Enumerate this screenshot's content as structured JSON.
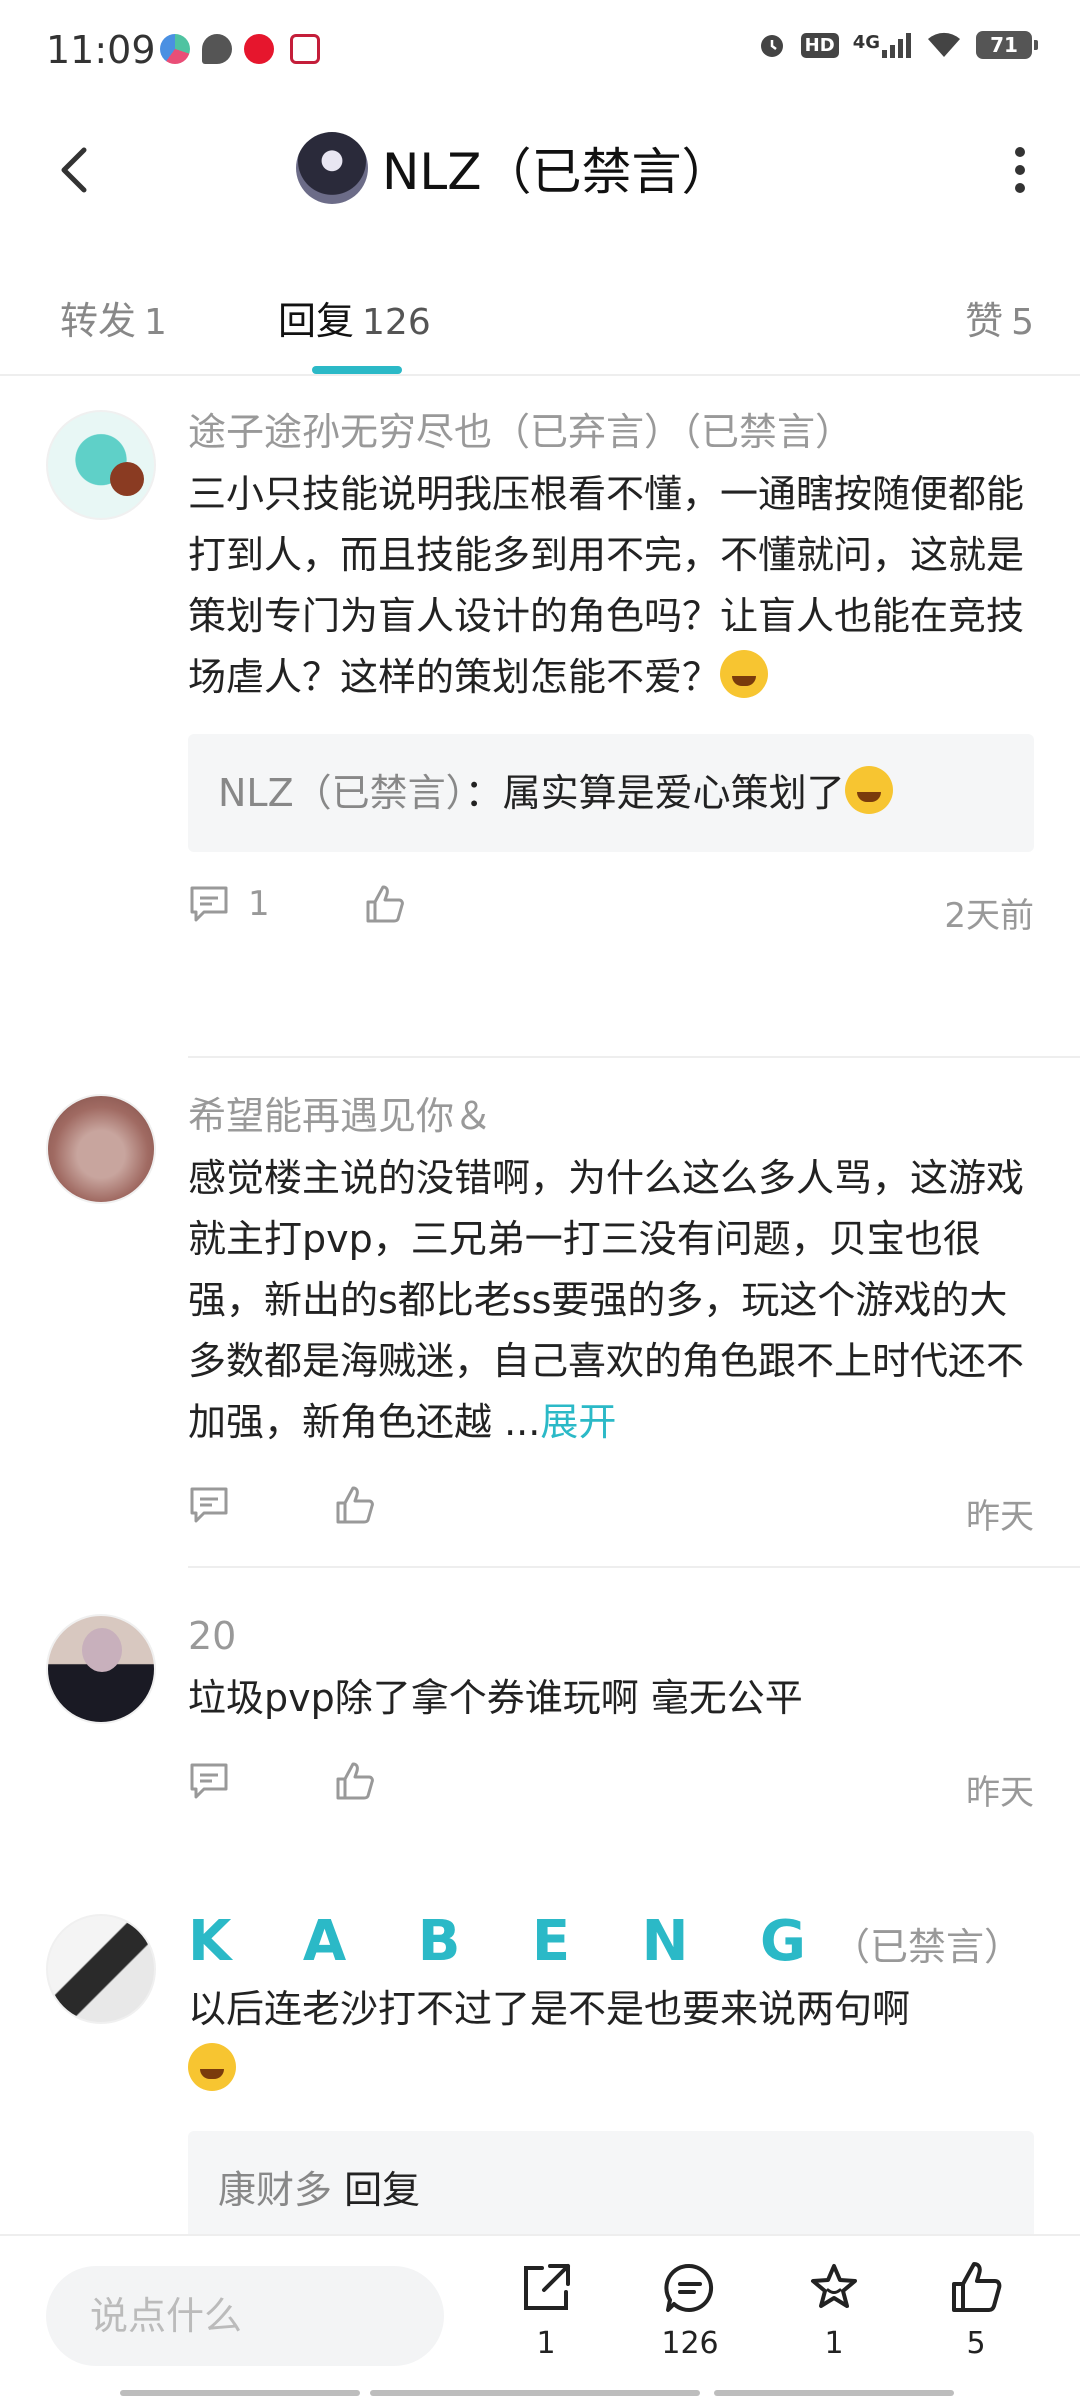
{
  "status": {
    "time": "11:09",
    "network": "4G",
    "hd": "HD",
    "battery": "71",
    "colors": {
      "weibo": "#e6162d",
      "chat": "#555555",
      "app": "#c41e3a"
    }
  },
  "header": {
    "title": "NLZ（已禁言）"
  },
  "tabs": [
    {
      "label": "转发",
      "count": "1"
    },
    {
      "label": "回复",
      "count": "126"
    },
    {
      "label": "赞",
      "count": "5"
    }
  ],
  "active_tab": "回复",
  "posts": [
    {
      "username": "途子途孙无穷尽也（已弃言）（已禁言）",
      "text": "三小只技能说明我压根看不懂，一通瞎按随便都能打到人，而且技能多到用不完，不懂就问，这就是策划专门为盲人设计的角色吗？让盲人也能在竞技场虐人？这样的策划怎能不爱？",
      "emoji": "grin-emoji",
      "quote": {
        "name": "NLZ（已禁言）",
        "text": "：属实算是爱心策划了"
      },
      "comment_count": "1",
      "date": "2天前"
    },
    {
      "username": "希望能再遇见你＆",
      "text": "感觉楼主说的没错啊，为什么这么多人骂，这游戏就主打pvp，三兄弟一打三没有问题，贝宝也很强，新出的s都比老ss要强的多，玩这个游戏的大多数都是海贼迷，自己喜欢的角色跟不上时代还不加强，新角色还越 ...",
      "expand_label": "展开",
      "date": "昨天"
    },
    {
      "username": "20",
      "text": "垃圾pvp除了拿个券谁玩啊 毫无公平",
      "date": "昨天"
    },
    {
      "username": "K A B E N G",
      "username_suffix": "（已禁言）",
      "text": "以后连老沙打不过了是不是也要来说两句啊",
      "quote_partial": {
        "name": "康财多",
        "text": "回复"
      }
    }
  ],
  "bottom": {
    "input_placeholder": "说点什么",
    "share_count": "1",
    "comment_count": "126",
    "favorite_count": "1",
    "like_count": "5"
  },
  "accent_color": "#2bb9c7"
}
